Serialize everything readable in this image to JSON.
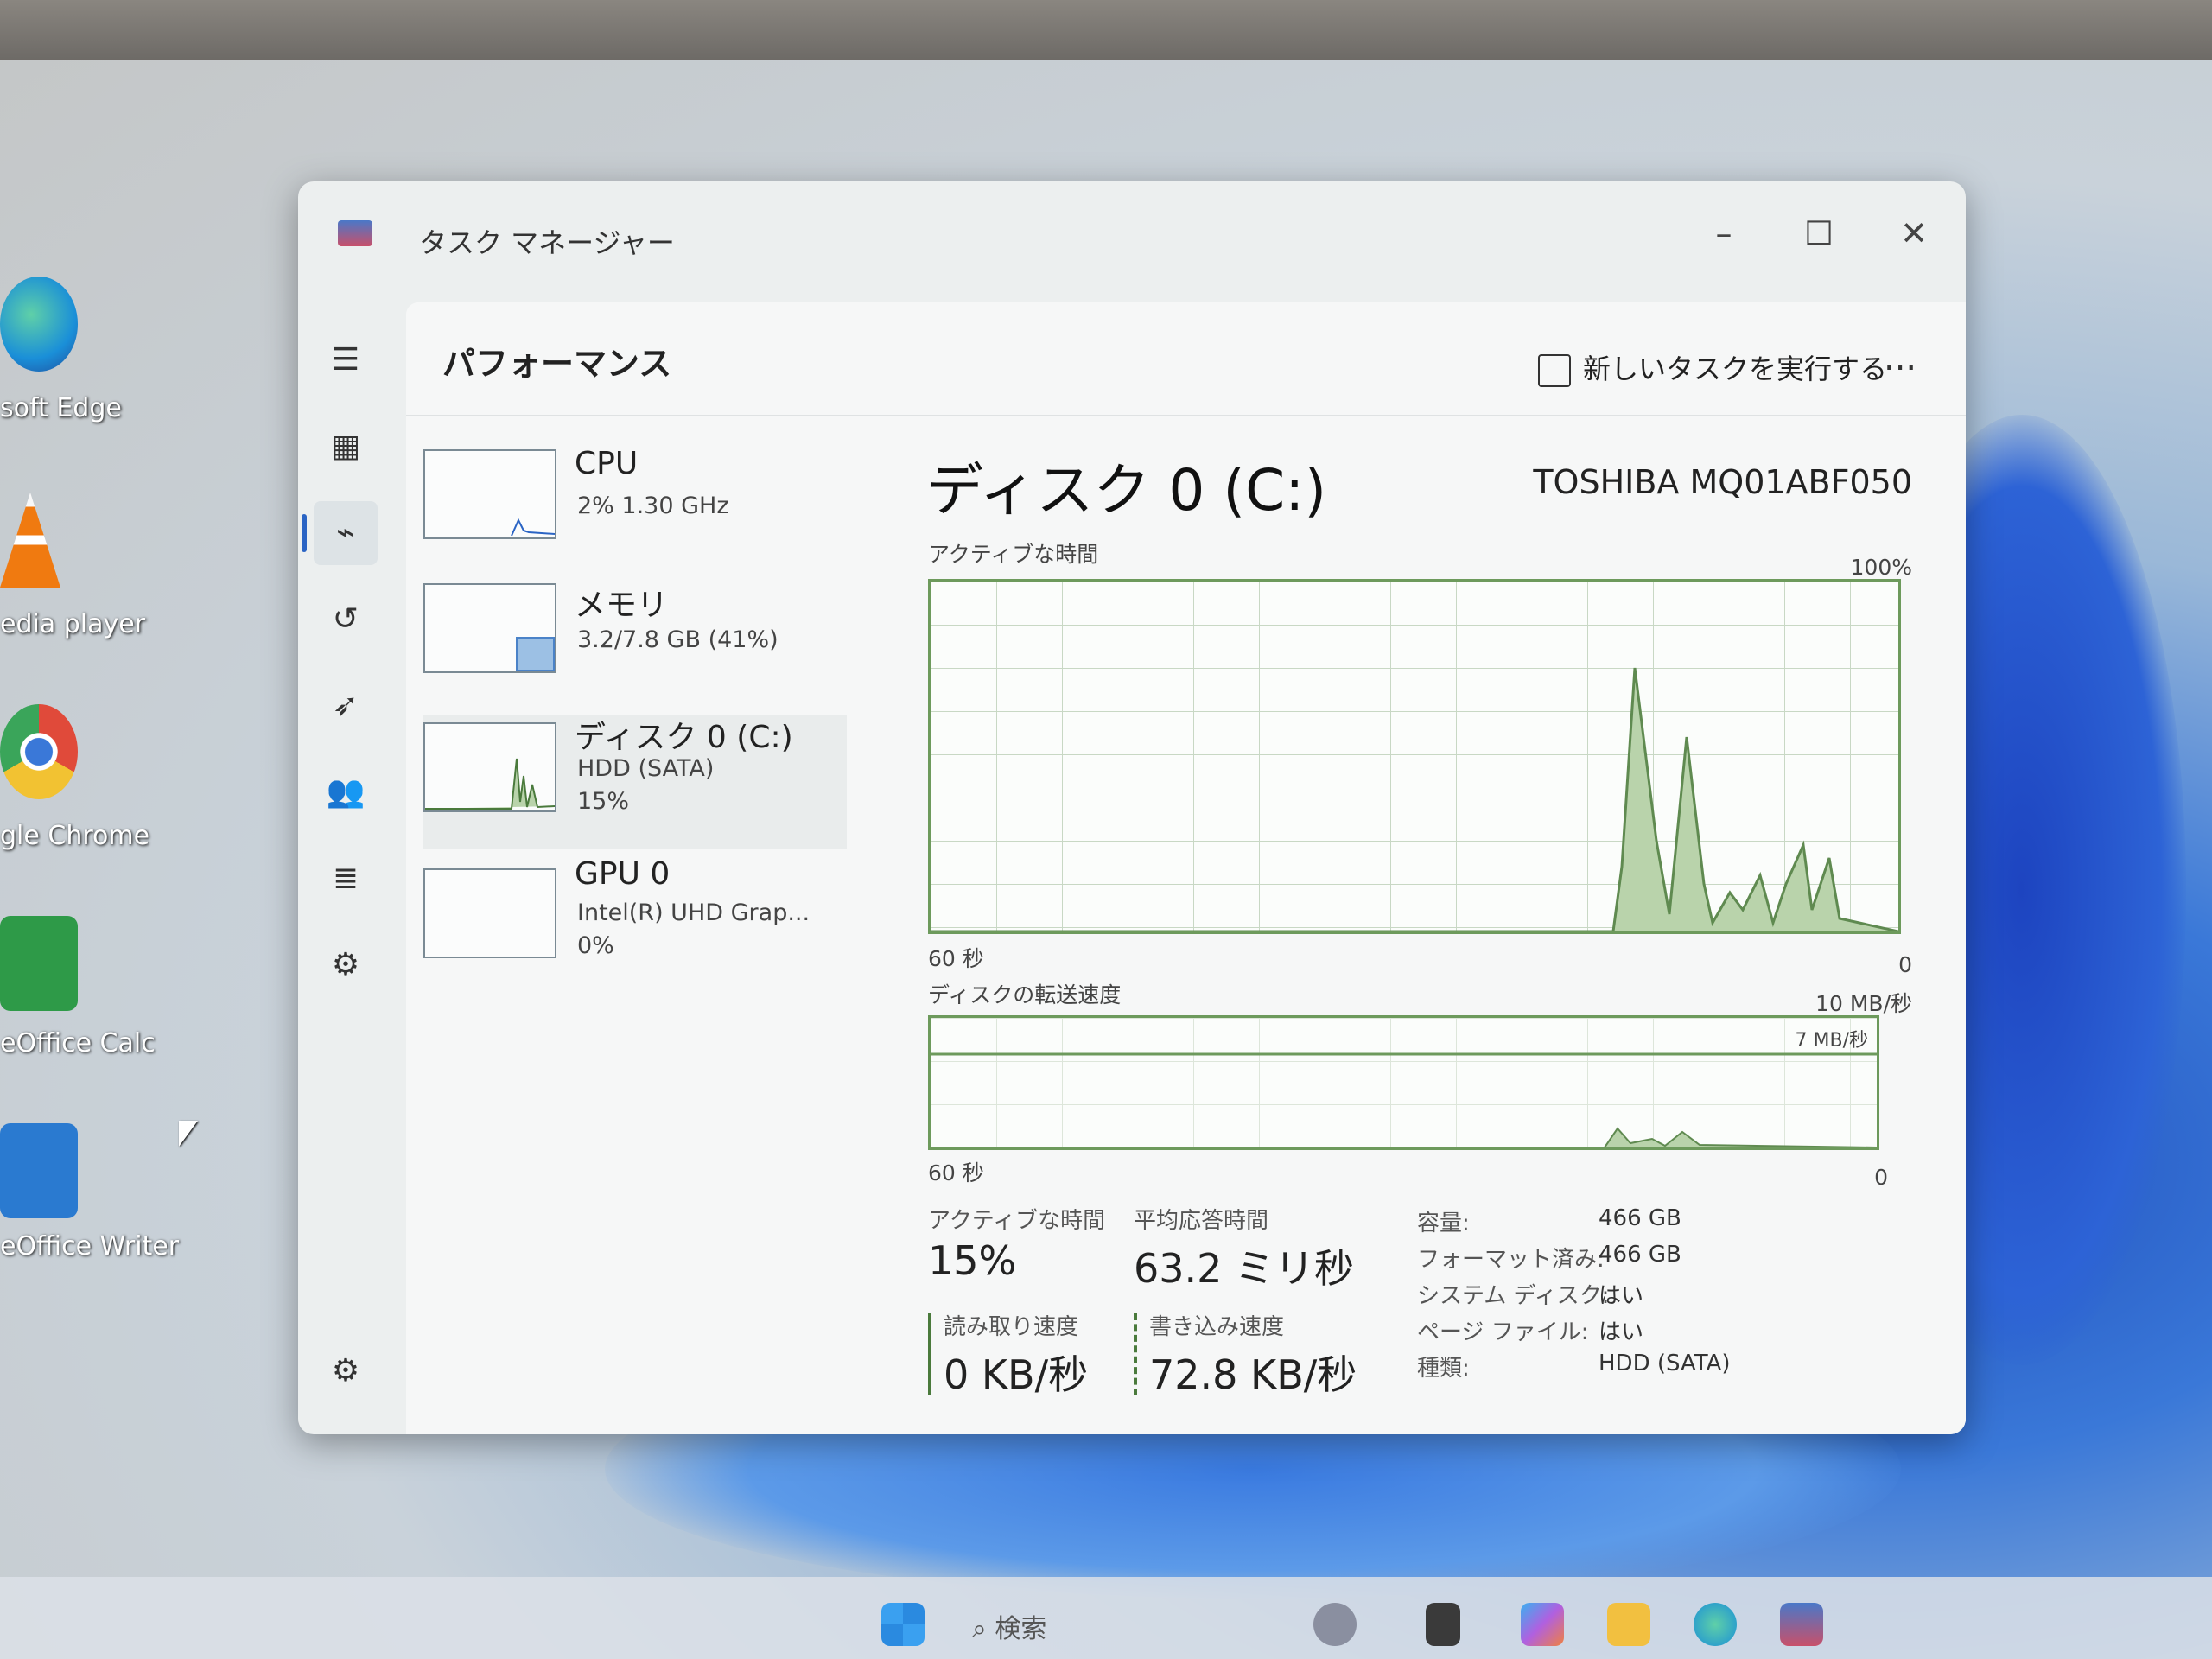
{
  "desktop": {
    "icons": [
      {
        "label": "soft Edge",
        "icon": "edge-icon",
        "color": "#1a8fd8"
      },
      {
        "label": "edia player",
        "icon": "vlc-icon",
        "color": "#f07a10"
      },
      {
        "label": "gle Chrome",
        "icon": "chrome-icon",
        "color": "#e04a3a"
      },
      {
        "label": "eOffice Calc",
        "icon": "calc-icon",
        "color": "#2e9a48"
      },
      {
        "label": "eOffice Writer",
        "icon": "writer-icon",
        "color": "#2a7ad0"
      }
    ]
  },
  "window": {
    "title": "タスク マネージャー",
    "controls": {
      "minimize": "–",
      "maximize": "☐",
      "close": "✕"
    }
  },
  "nav": {
    "items": [
      {
        "name": "menu",
        "glyph": "☰"
      },
      {
        "name": "processes",
        "glyph": "▦"
      },
      {
        "name": "performance",
        "glyph": "⌁",
        "active": true
      },
      {
        "name": "app-history",
        "glyph": "↺"
      },
      {
        "name": "startup",
        "glyph": "➶"
      },
      {
        "name": "users",
        "glyph": "👥"
      },
      {
        "name": "details",
        "glyph": "≣"
      },
      {
        "name": "services",
        "glyph": "⚙"
      }
    ],
    "settings_glyph": "⚙"
  },
  "header": {
    "title": "パフォーマンス",
    "run_task_label": "新しいタスクを実行する",
    "more_label": "..."
  },
  "resources": [
    {
      "name": "CPU",
      "line1": "2%  1.30 GHz",
      "line2": ""
    },
    {
      "name": "メモリ",
      "line1": "3.2/7.8 GB (41%)",
      "line2": ""
    },
    {
      "name": "ディスク 0 (C:)",
      "line1": "HDD (SATA)",
      "line2": "15%",
      "selected": true
    },
    {
      "name": "GPU 0",
      "line1": "Intel(R) UHD Grap...",
      "line2": "0%"
    }
  ],
  "detail": {
    "title": "ディスク 0 (C:)",
    "model": "TOSHIBA MQ01ABF050",
    "active_graph": {
      "label": "アクティブな時間",
      "max": "100%",
      "time": "60 秒",
      "min": "0"
    },
    "transfer_graph": {
      "label": "ディスクの転送速度",
      "max": "10 MB/秒",
      "mid": "7 MB/秒",
      "time": "60 秒",
      "min": "0"
    },
    "stats": {
      "active_label": "アクティブな時間",
      "active_value": "15%",
      "response_label": "平均応答時間",
      "response_value": "63.2 ミリ秒",
      "read_label": "読み取り速度",
      "read_value": "0 KB/秒",
      "write_label": "書き込み速度",
      "write_value": "72.8 KB/秒"
    },
    "properties": [
      {
        "key": "容量:",
        "value": "466 GB"
      },
      {
        "key": "フォーマット済み:",
        "value": "466 GB"
      },
      {
        "key": "システム ディスク:",
        "value": "はい"
      },
      {
        "key": "ページ ファイル:",
        "value": "はい"
      },
      {
        "key": "種類:",
        "value": "HDD (SATA)"
      }
    ]
  },
  "taskbar": {
    "search_label": "検索"
  },
  "colors": {
    "accent": "#2a64c4",
    "graph_line": "#6d9a5c",
    "graph_fill": "#b9d3ab"
  }
}
